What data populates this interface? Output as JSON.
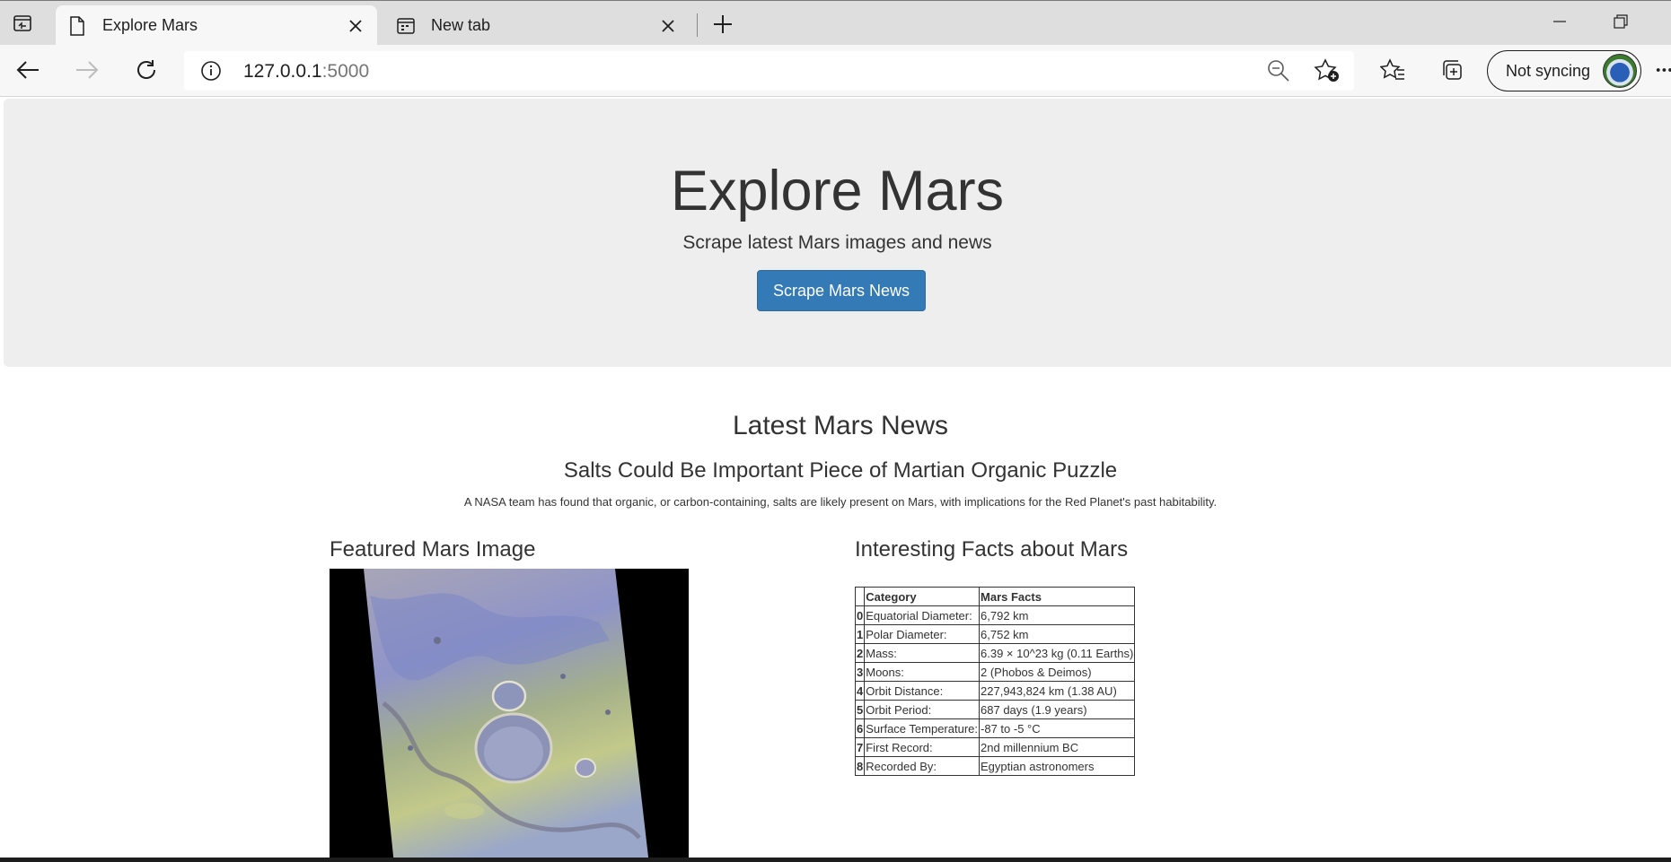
{
  "browser": {
    "tabs": [
      {
        "title": "Explore Mars",
        "active": true
      },
      {
        "title": "New tab",
        "active": false
      }
    ],
    "url_host": "127.0.0.1",
    "url_port": ":5000",
    "sync_label": "Not syncing"
  },
  "hero": {
    "title": "Explore Mars",
    "lead": "Scrape latest Mars images and news",
    "button": "Scrape Mars News"
  },
  "news": {
    "heading": "Latest Mars News",
    "title": "Salts Could Be Important Piece of Martian Organic Puzzle",
    "paragraph": "A NASA team has found that organic, or carbon-containing, salts are likely present on Mars, with implications for the Red Planet's past habitability."
  },
  "featured": {
    "heading": "Featured Mars Image"
  },
  "facts": {
    "heading": "Interesting Facts about Mars",
    "columns": [
      "",
      "Category",
      "Mars Facts"
    ],
    "rows": [
      [
        "0",
        "Equatorial Diameter:",
        "6,792 km"
      ],
      [
        "1",
        "Polar Diameter:",
        "6,752 km"
      ],
      [
        "2",
        "Mass:",
        "6.39 × 10^23 kg (0.11 Earths)"
      ],
      [
        "3",
        "Moons:",
        "2 (Phobos & Deimos)"
      ],
      [
        "4",
        "Orbit Distance:",
        "227,943,824 km (1.38 AU)"
      ],
      [
        "5",
        "Orbit Period:",
        "687 days (1.9 years)"
      ],
      [
        "6",
        "Surface Temperature:",
        "-87 to -5 °C"
      ],
      [
        "7",
        "First Record:",
        "2nd millennium BC"
      ],
      [
        "8",
        "Recorded By:",
        "Egyptian astronomers"
      ]
    ]
  },
  "icons": {
    "tab_actions": "tab-actions-icon",
    "page_tab": "page-icon",
    "newtab_page": "new-tab-page-icon",
    "close": "close-icon",
    "add": "plus-icon",
    "minimize": "minimize-icon",
    "restore": "restore-icon",
    "back": "back-arrow-icon",
    "forward": "forward-arrow-icon",
    "refresh": "refresh-icon",
    "info": "info-icon",
    "zoom_out": "zoom-out-icon",
    "add_favorite": "add-favorite-icon",
    "favorites": "favorites-icon",
    "collections": "collections-icon",
    "more": "more-icon"
  },
  "colors": {
    "primary_button": "#337ab7",
    "jumbotron_bg": "#eeeeee",
    "text": "#333333"
  }
}
